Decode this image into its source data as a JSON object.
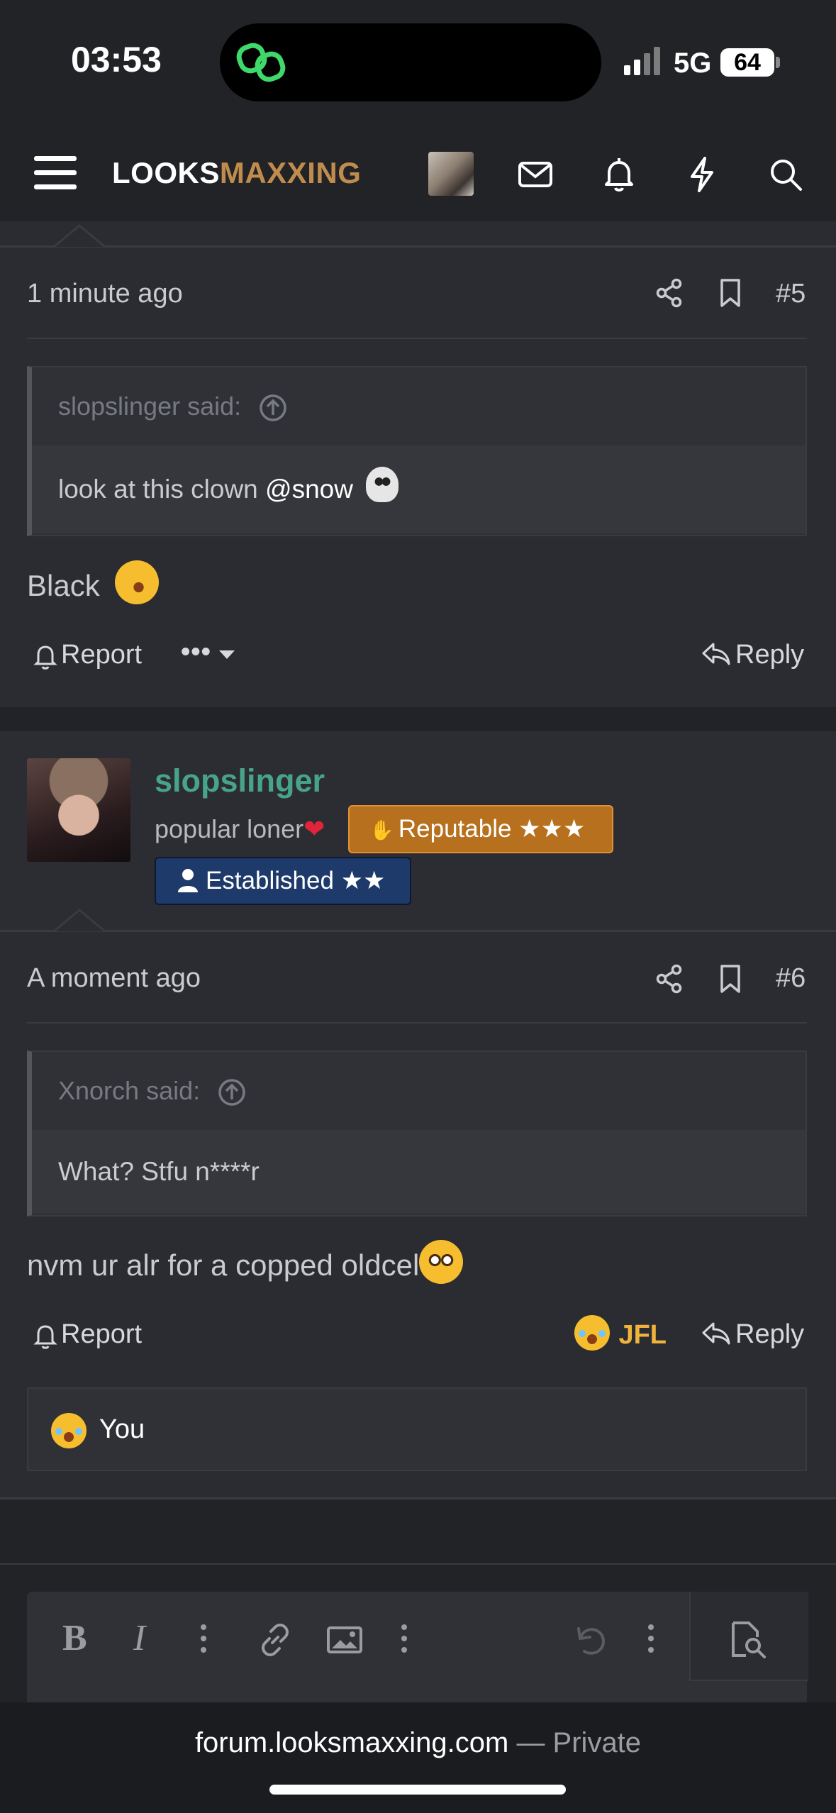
{
  "status": {
    "time": "03:53",
    "network": "5G",
    "battery": "64"
  },
  "header": {
    "logo_part1": "LOOKS",
    "logo_part2": "MAXXING",
    "icons": [
      "menu-icon",
      "avatar",
      "mail-icon",
      "bell-icon",
      "lightning-icon",
      "search-icon"
    ]
  },
  "post5": {
    "time": "1 minute ago",
    "number": "#5",
    "quote_author": "slopslinger said:",
    "quote_text": "look at this clown",
    "quote_mention": "@snow",
    "body": "Black",
    "report_label": "Report",
    "more_label": "•••",
    "reply_label": "Reply"
  },
  "post6": {
    "username": "slopslinger",
    "user_title": "popular loner",
    "badge_reputable": "Reputable ★★★",
    "badge_established": "Established ★★",
    "time": "A moment ago",
    "number": "#6",
    "quote_author": "Xnorch said:",
    "quote_text": "What? Stfu n****r",
    "body": "nvm ur alr for a copped oldcel",
    "report_label": "Report",
    "reaction_label": "JFL",
    "reply_label": "Reply",
    "reacted_by": "You"
  },
  "browser": {
    "domain": "forum.looksmaxxing.com",
    "mode": "— Private"
  },
  "colors": {
    "background": "#222327",
    "post_bg": "#2b2c31",
    "logo_accent": "#c08c4d",
    "username": "#47a389",
    "reputable_badge": "#b7701d",
    "established_badge": "#1d3a6a",
    "jfl": "#f0b43c"
  }
}
